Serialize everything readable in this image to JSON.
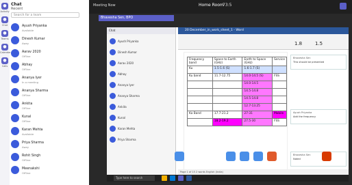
{
  "teams": {
    "title": "Chat",
    "subtitle": "Recent",
    "search_placeholder": "Search for a team",
    "rail": [
      "Activity",
      "Chat",
      "Teams",
      "Calendar",
      "Calls"
    ],
    "contacts": [
      {
        "name": "Ayush Priyanka",
        "status": "Available"
      },
      {
        "name": "Dinesh Kumar",
        "status": "Away"
      },
      {
        "name": "Aarav 2020",
        "status": "Offline"
      },
      {
        "name": "Abhay",
        "status": "Offline"
      },
      {
        "name": "Ananya Iyer",
        "status": "In a meeting"
      },
      {
        "name": "Ananya Sharma",
        "status": "Offline"
      },
      {
        "name": "Ankita",
        "status": "Offline"
      },
      {
        "name": "Kunal",
        "status": "Offline"
      },
      {
        "name": "Karan Mehta",
        "status": "Available"
      },
      {
        "name": "Priya Sharma",
        "status": "Away"
      },
      {
        "name": "Rohit Singh",
        "status": "Offline"
      },
      {
        "name": "Meenakshi",
        "status": "Offline"
      }
    ]
  },
  "meeting": {
    "name": "Meeting Now",
    "title": "Home Room",
    "timer": "73:5",
    "sharing": "Bhavesha Sen, BPO"
  },
  "word": {
    "title": "20 December_in_work_sheet_1 - Word",
    "font_size": "1.8",
    "font_size2": "1.5",
    "table": [
      [
        "Frequency band",
        "Space to Earth (GHz)",
        "Earth to Space (GHz)",
        "Service"
      ],
      [
        "Ku",
        "1.5-1.6 (S)",
        "1.6-1.7 (S)",
        ""
      ],
      [
        "Ku band",
        "11.7-12.75",
        "14.0-14.5 (S)",
        "FSS"
      ],
      [
        "",
        "",
        "14.0-14.5",
        ""
      ],
      [
        "",
        "",
        "14.5-14.8",
        ""
      ],
      [
        "",
        "",
        "14.5-14.8",
        ""
      ],
      [
        "",
        "",
        "12.7-13.25",
        ""
      ],
      [
        "Ka Band",
        "17.7-21.2",
        "27-31",
        "Mobile"
      ],
      [
        "",
        "18.2-19.2",
        "27.5-30",
        "FSS"
      ]
    ],
    "comments": [
      {
        "author": "Bhavesha Sen",
        "text": "This should be presented"
      },
      {
        "author": "Ayush Priyanka",
        "text": "Add the frequency"
      },
      {
        "author": "Bhavesha Sen",
        "text": "Noted"
      }
    ],
    "status": "Page 1 of 15   2 words   English (India)"
  },
  "taskbar": {
    "search": "Type here to search"
  }
}
